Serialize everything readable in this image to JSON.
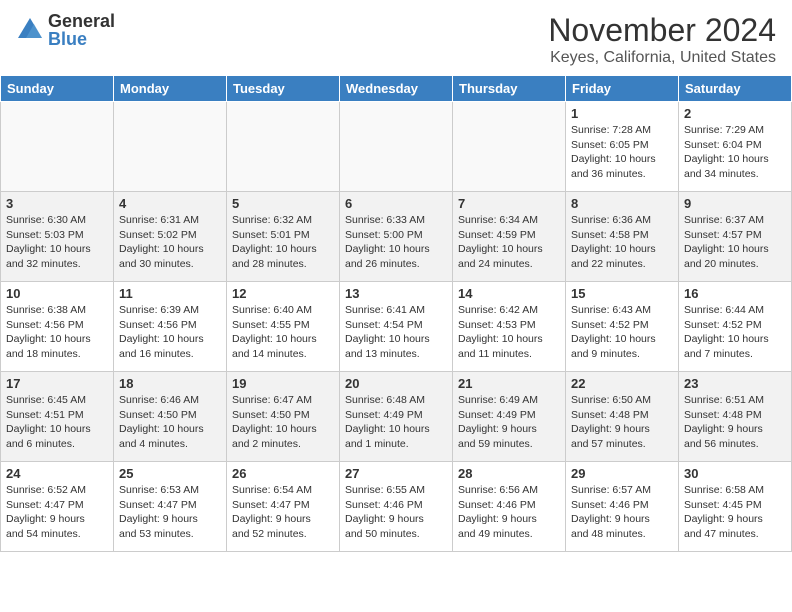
{
  "header": {
    "logo_general": "General",
    "logo_blue": "Blue",
    "title": "November 2024",
    "subtitle": "Keyes, California, United States"
  },
  "days_of_week": [
    "Sunday",
    "Monday",
    "Tuesday",
    "Wednesday",
    "Thursday",
    "Friday",
    "Saturday"
  ],
  "weeks": [
    [
      {
        "day": "",
        "info": ""
      },
      {
        "day": "",
        "info": ""
      },
      {
        "day": "",
        "info": ""
      },
      {
        "day": "",
        "info": ""
      },
      {
        "day": "",
        "info": ""
      },
      {
        "day": "1",
        "info": "Sunrise: 7:28 AM\nSunset: 6:05 PM\nDaylight: 10 hours\nand 36 minutes."
      },
      {
        "day": "2",
        "info": "Sunrise: 7:29 AM\nSunset: 6:04 PM\nDaylight: 10 hours\nand 34 minutes."
      }
    ],
    [
      {
        "day": "3",
        "info": "Sunrise: 6:30 AM\nSunset: 5:03 PM\nDaylight: 10 hours\nand 32 minutes."
      },
      {
        "day": "4",
        "info": "Sunrise: 6:31 AM\nSunset: 5:02 PM\nDaylight: 10 hours\nand 30 minutes."
      },
      {
        "day": "5",
        "info": "Sunrise: 6:32 AM\nSunset: 5:01 PM\nDaylight: 10 hours\nand 28 minutes."
      },
      {
        "day": "6",
        "info": "Sunrise: 6:33 AM\nSunset: 5:00 PM\nDaylight: 10 hours\nand 26 minutes."
      },
      {
        "day": "7",
        "info": "Sunrise: 6:34 AM\nSunset: 4:59 PM\nDaylight: 10 hours\nand 24 minutes."
      },
      {
        "day": "8",
        "info": "Sunrise: 6:36 AM\nSunset: 4:58 PM\nDaylight: 10 hours\nand 22 minutes."
      },
      {
        "day": "9",
        "info": "Sunrise: 6:37 AM\nSunset: 4:57 PM\nDaylight: 10 hours\nand 20 minutes."
      }
    ],
    [
      {
        "day": "10",
        "info": "Sunrise: 6:38 AM\nSunset: 4:56 PM\nDaylight: 10 hours\nand 18 minutes."
      },
      {
        "day": "11",
        "info": "Sunrise: 6:39 AM\nSunset: 4:56 PM\nDaylight: 10 hours\nand 16 minutes."
      },
      {
        "day": "12",
        "info": "Sunrise: 6:40 AM\nSunset: 4:55 PM\nDaylight: 10 hours\nand 14 minutes."
      },
      {
        "day": "13",
        "info": "Sunrise: 6:41 AM\nSunset: 4:54 PM\nDaylight: 10 hours\nand 13 minutes."
      },
      {
        "day": "14",
        "info": "Sunrise: 6:42 AM\nSunset: 4:53 PM\nDaylight: 10 hours\nand 11 minutes."
      },
      {
        "day": "15",
        "info": "Sunrise: 6:43 AM\nSunset: 4:52 PM\nDaylight: 10 hours\nand 9 minutes."
      },
      {
        "day": "16",
        "info": "Sunrise: 6:44 AM\nSunset: 4:52 PM\nDaylight: 10 hours\nand 7 minutes."
      }
    ],
    [
      {
        "day": "17",
        "info": "Sunrise: 6:45 AM\nSunset: 4:51 PM\nDaylight: 10 hours\nand 6 minutes."
      },
      {
        "day": "18",
        "info": "Sunrise: 6:46 AM\nSunset: 4:50 PM\nDaylight: 10 hours\nand 4 minutes."
      },
      {
        "day": "19",
        "info": "Sunrise: 6:47 AM\nSunset: 4:50 PM\nDaylight: 10 hours\nand 2 minutes."
      },
      {
        "day": "20",
        "info": "Sunrise: 6:48 AM\nSunset: 4:49 PM\nDaylight: 10 hours\nand 1 minute."
      },
      {
        "day": "21",
        "info": "Sunrise: 6:49 AM\nSunset: 4:49 PM\nDaylight: 9 hours\nand 59 minutes."
      },
      {
        "day": "22",
        "info": "Sunrise: 6:50 AM\nSunset: 4:48 PM\nDaylight: 9 hours\nand 57 minutes."
      },
      {
        "day": "23",
        "info": "Sunrise: 6:51 AM\nSunset: 4:48 PM\nDaylight: 9 hours\nand 56 minutes."
      }
    ],
    [
      {
        "day": "24",
        "info": "Sunrise: 6:52 AM\nSunset: 4:47 PM\nDaylight: 9 hours\nand 54 minutes."
      },
      {
        "day": "25",
        "info": "Sunrise: 6:53 AM\nSunset: 4:47 PM\nDaylight: 9 hours\nand 53 minutes."
      },
      {
        "day": "26",
        "info": "Sunrise: 6:54 AM\nSunset: 4:47 PM\nDaylight: 9 hours\nand 52 minutes."
      },
      {
        "day": "27",
        "info": "Sunrise: 6:55 AM\nSunset: 4:46 PM\nDaylight: 9 hours\nand 50 minutes."
      },
      {
        "day": "28",
        "info": "Sunrise: 6:56 AM\nSunset: 4:46 PM\nDaylight: 9 hours\nand 49 minutes."
      },
      {
        "day": "29",
        "info": "Sunrise: 6:57 AM\nSunset: 4:46 PM\nDaylight: 9 hours\nand 48 minutes."
      },
      {
        "day": "30",
        "info": "Sunrise: 6:58 AM\nSunset: 4:45 PM\nDaylight: 9 hours\nand 47 minutes."
      }
    ]
  ]
}
